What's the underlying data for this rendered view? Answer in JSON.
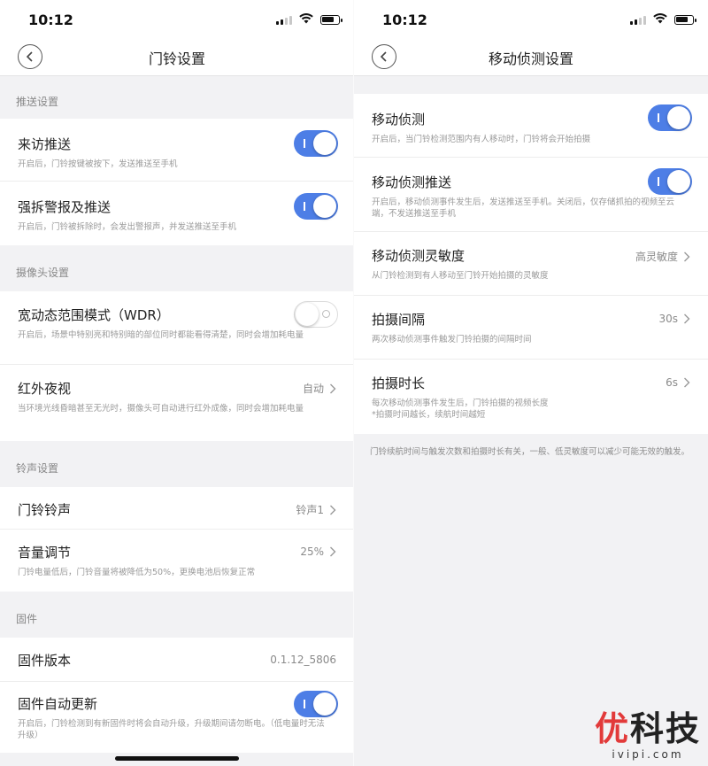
{
  "status_bar": {
    "time": "10:12"
  },
  "left": {
    "title": "门铃设置",
    "sections": {
      "push": {
        "header": "推送设置",
        "visitor": {
          "label": "来访推送",
          "desc": "开启后，门铃按键被按下，发送推送至手机",
          "on": true
        },
        "tamper": {
          "label": "强拆警报及推送",
          "desc": "开启后，门铃被拆除时，会发出警报声，并发送推送至手机",
          "on": true
        }
      },
      "camera": {
        "header": "摄像头设置",
        "wdr": {
          "label": "宽动态范围模式（WDR）",
          "desc": "开启后，场景中特别亮和特别暗的部位同时都能看得清楚，同时会增加耗电量",
          "on": false
        },
        "night": {
          "label": "红外夜视",
          "value": "自动",
          "desc": "当环境光线昏暗甚至无光时，摄像头可自动进行红外成像，同时会增加耗电量"
        }
      },
      "ring": {
        "header": "铃声设置",
        "tone": {
          "label": "门铃铃声",
          "value": "铃声1"
        },
        "volume": {
          "label": "音量调节",
          "value": "25%",
          "desc": "门铃电量低后，门铃音量将被降低为50%，更换电池后恢复正常"
        }
      },
      "firmware": {
        "header": "固件",
        "version": {
          "label": "固件版本",
          "value": "0.1.12_5806"
        },
        "auto_update": {
          "label": "固件自动更新",
          "desc": "开启后，门铃检测到有新固件时将会自动升级，升级期间请勿断电。（低电量时无法升级）",
          "on": true
        }
      }
    }
  },
  "right": {
    "title": "移动侦测设置",
    "motion": {
      "label": "移动侦测",
      "desc": "开启后，当门铃检测范围内有人移动时，门铃将会开始拍摄",
      "on": true
    },
    "motion_push": {
      "label": "移动侦测推送",
      "desc": "开启后，移动侦测事件发生后，发送推送至手机。关闭后，仅存储抓拍的视频至云端，不发送推送至手机",
      "on": true
    },
    "sensitivity": {
      "label": "移动侦测灵敏度",
      "value": "高灵敏度",
      "desc": "从门铃检测到有人移动至门铃开始拍摄的灵敏度"
    },
    "interval": {
      "label": "拍摄间隔",
      "value": "30s",
      "desc": "两次移动侦测事件触发门铃拍摄的间隔时间"
    },
    "duration": {
      "label": "拍摄时长",
      "value": "6s",
      "desc": "每次移动侦测事件发生后，门铃拍摄的视频长度",
      "note": "*拍摄时间越长，续航时间越短"
    },
    "footnote": "门铃续航时间与触发次数和拍摄时长有关，一般、低灵敏度可以减少可能无效的触发。"
  },
  "watermark": {
    "main_1": "优",
    "main_2": "科技",
    "sub": "ivipi.com"
  },
  "colors": {
    "toggle_on": "#4d7ee6",
    "background": "#f2f2f4",
    "watermark_red": "#e23a3a"
  },
  "icons": [
    "back-icon",
    "chevron-right-icon",
    "signal-icon",
    "wifi-icon",
    "battery-icon"
  ]
}
